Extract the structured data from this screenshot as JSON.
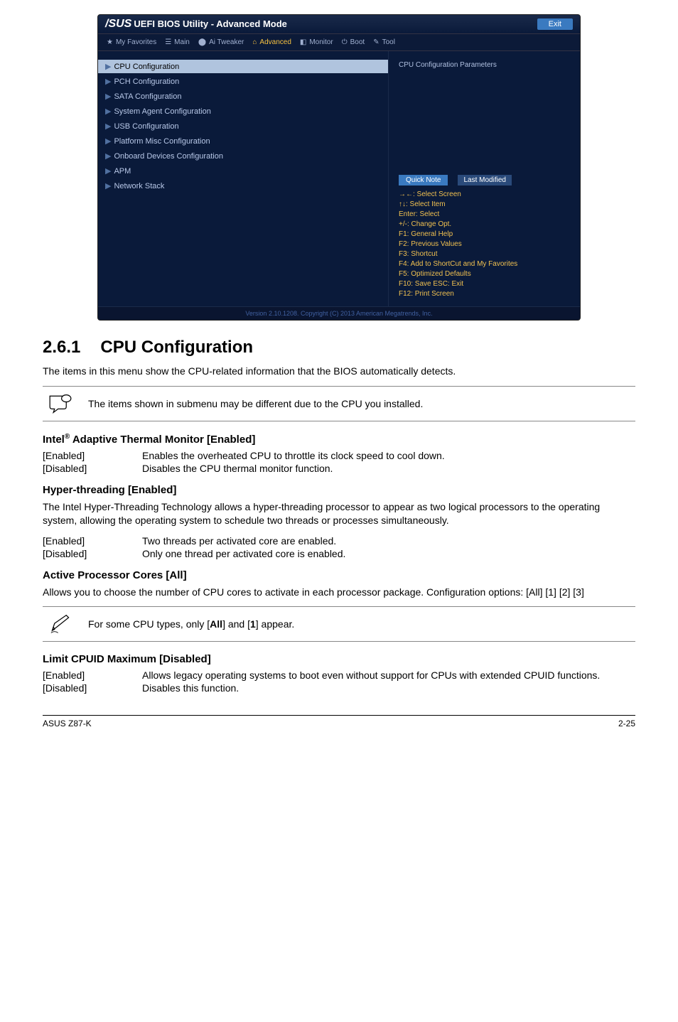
{
  "bios": {
    "brand": "/SUS",
    "title": "UEFI BIOS Utility - Advanced Mode",
    "exit": "Exit",
    "tabs": {
      "fav": "My Favorites",
      "main": "Main",
      "tweaker": "Ai Tweaker",
      "advanced": "Advanced",
      "monitor": "Monitor",
      "boot": "Boot",
      "tool": "Tool"
    },
    "left": {
      "cpu": "CPU Configuration",
      "pch": "PCH Configuration",
      "sata": "SATA Configuration",
      "agent": "System Agent Configuration",
      "usb": "USB Configuration",
      "platform": "Platform Misc Configuration",
      "onboard": "Onboard Devices Configuration",
      "apm": "APM",
      "network": "Network Stack"
    },
    "rightTop": "CPU Configuration Parameters",
    "quickNote": "Quick Note",
    "lastMod": "Last Modified",
    "hints": {
      "l1": "→←: Select Screen",
      "l2": "↑↓: Select Item",
      "l3": "Enter: Select",
      "l4": "+/-: Change Opt.",
      "l5": "F1: General Help",
      "l6": "F2: Previous Values",
      "l7": "F3: Shortcut",
      "l8": "F4: Add to ShortCut and My Favorites",
      "l9": "F5: Optimized Defaults",
      "l10": "F10: Save  ESC: Exit",
      "l11": "F12: Print Screen"
    },
    "footer": "Version 2.10.1208. Copyright (C) 2013 American Megatrends, Inc."
  },
  "section": {
    "num": "2.6.1",
    "title": "CPU Configuration",
    "intro": "The items in this menu show the CPU-related information that the BIOS automatically detects.",
    "note1": "The items shown in submenu may be different due to the CPU you installed."
  },
  "h_intel": "Intel",
  "h_intel_rest": " Adaptive Thermal Monitor [Enabled]",
  "intel": {
    "enabled_k": "[Enabled]",
    "enabled_v": "Enables the overheated CPU to throttle its clock speed to cool down.",
    "disabled_k": "[Disabled]",
    "disabled_v": "Disables the CPU thermal monitor function."
  },
  "h_hyper": "Hyper-threading [Enabled]",
  "hyper_body": "The Intel Hyper-Threading Technology allows a hyper-threading processor to appear as two logical processors to the operating system, allowing the operating system to schedule two threads or processes simultaneously.",
  "hyper": {
    "enabled_k": "[Enabled]",
    "enabled_v": "Two threads per activated core are enabled.",
    "disabled_k": "[Disabled]",
    "disabled_v": "Only one thread per activated core is enabled."
  },
  "h_active": "Active Processor Cores [All]",
  "active_body": "Allows you to choose the number of CPU cores to activate in each processor package. Configuration options: [All] [1] [2] [3]",
  "note2_a": "For some CPU types, only [",
  "note2_b": "All",
  "note2_c": "] and [",
  "note2_d": "1",
  "note2_e": "] appear.",
  "h_limit": "Limit CPUID Maximum [Disabled]",
  "limit": {
    "enabled_k": "[Enabled]",
    "enabled_v": "Allows legacy operating systems to boot even without support for CPUs with extended CPUID functions.",
    "disabled_k": "[Disabled]",
    "disabled_v": "Disables this function."
  },
  "footer": {
    "left": "ASUS Z87-K",
    "right": "2-25"
  }
}
